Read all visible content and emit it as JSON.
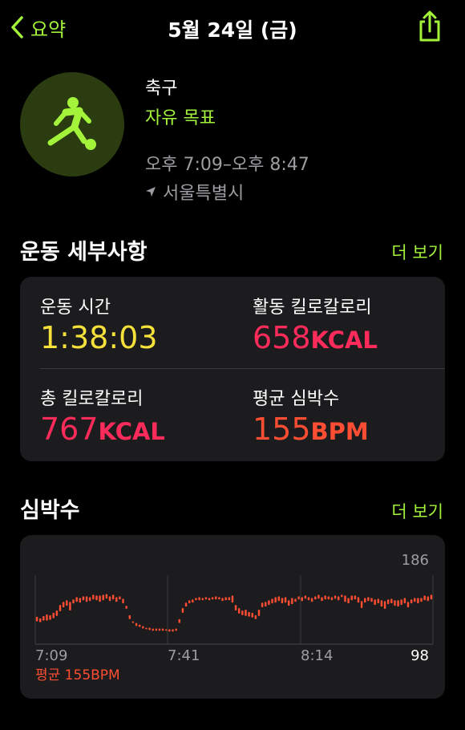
{
  "nav": {
    "back_label": "요약",
    "title": "5월 24일 (금)"
  },
  "workout": {
    "name": "축구",
    "goal": "자유 목표",
    "time_range": "오후 7:09–오후 8:47",
    "location": "서울특별시"
  },
  "details": {
    "title": "운동 세부사항",
    "more": "더 보기",
    "metrics": [
      {
        "label": "운동 시간",
        "value": "1:38:03",
        "unit": "",
        "color": "#f5e13a"
      },
      {
        "label": "활동 킬로칼로리",
        "value": "658",
        "unit": "KCAL",
        "color": "#fc2b5a"
      },
      {
        "label": "총 킬로칼로리",
        "value": "767",
        "unit": "KCAL",
        "color": "#fc2b5a"
      },
      {
        "label": "평균 심박수",
        "value": "155",
        "unit": "BPM",
        "color": "#fd4d32"
      }
    ]
  },
  "heart": {
    "title": "심박수",
    "more": "더 보기",
    "avg_label": "평균 155BPM"
  },
  "colors": {
    "accent": "#a3f33b",
    "heart_line": "#fd4d32"
  },
  "chart_data": {
    "type": "bar",
    "ylim": [
      98,
      186
    ],
    "y_tick_labels": [
      "186",
      "98"
    ],
    "x_tick_labels": [
      "7:09",
      "7:41",
      "8:14"
    ],
    "values": [
      [
        133,
        127
      ],
      [
        131,
        126
      ],
      [
        134,
        128
      ],
      [
        136,
        128
      ],
      [
        135,
        129
      ],
      [
        138,
        131
      ],
      [
        141,
        134
      ],
      [
        148,
        140
      ],
      [
        152,
        145
      ],
      [
        154,
        147
      ],
      [
        152,
        141
      ],
      [
        155,
        150
      ],
      [
        158,
        152
      ],
      [
        157,
        151
      ],
      [
        159,
        154
      ],
      [
        159,
        152
      ],
      [
        158,
        153
      ],
      [
        161,
        155
      ],
      [
        160,
        154
      ],
      [
        160,
        152
      ],
      [
        161,
        154
      ],
      [
        162,
        156
      ],
      [
        159,
        153
      ],
      [
        161,
        155
      ],
      [
        158,
        152
      ],
      [
        159,
        155
      ],
      [
        156,
        150
      ],
      [
        147,
        143
      ],
      [
        135,
        130
      ],
      [
        127,
        125
      ],
      [
        125,
        121
      ],
      [
        123,
        120
      ],
      [
        121,
        118
      ],
      [
        119,
        117
      ],
      [
        119,
        116
      ],
      [
        118,
        115
      ],
      [
        118,
        115
      ],
      [
        118,
        115
      ],
      [
        118,
        115
      ],
      [
        117,
        115
      ],
      [
        117,
        114
      ],
      [
        117,
        114
      ],
      [
        118,
        115
      ],
      [
        130,
        125
      ],
      [
        144,
        138
      ],
      [
        151,
        146
      ],
      [
        154,
        150
      ],
      [
        155,
        151
      ],
      [
        157,
        154
      ],
      [
        158,
        154
      ],
      [
        157,
        154
      ],
      [
        158,
        155
      ],
      [
        157,
        154
      ],
      [
        158,
        155
      ],
      [
        159,
        155
      ],
      [
        158,
        155
      ],
      [
        157,
        153
      ],
      [
        158,
        154
      ],
      [
        158,
        154
      ],
      [
        160,
        151
      ],
      [
        148,
        141
      ],
      [
        144,
        137
      ],
      [
        141,
        135
      ],
      [
        142,
        134
      ],
      [
        139,
        133
      ],
      [
        138,
        132
      ],
      [
        135,
        130
      ],
      [
        142,
        134
      ],
      [
        151,
        145
      ],
      [
        152,
        146
      ],
      [
        154,
        148
      ],
      [
        156,
        150
      ],
      [
        158,
        151
      ],
      [
        159,
        153
      ],
      [
        157,
        150
      ],
      [
        158,
        151
      ],
      [
        154,
        147
      ],
      [
        157,
        149
      ],
      [
        156,
        152
      ],
      [
        159,
        155
      ],
      [
        158,
        153
      ],
      [
        160,
        156
      ],
      [
        158,
        154
      ],
      [
        157,
        152
      ],
      [
        159,
        155
      ],
      [
        161,
        156
      ],
      [
        158,
        153
      ],
      [
        160,
        155
      ],
      [
        159,
        155
      ],
      [
        158,
        154
      ],
      [
        160,
        156
      ],
      [
        159,
        154
      ],
      [
        161,
        158
      ],
      [
        160,
        152
      ],
      [
        157,
        150
      ],
      [
        160,
        154
      ],
      [
        160,
        155
      ],
      [
        158,
        151
      ],
      [
        153,
        144
      ],
      [
        157,
        151
      ],
      [
        158,
        153
      ],
      [
        157,
        152
      ],
      [
        155,
        148
      ],
      [
        156,
        150
      ],
      [
        154,
        146
      ],
      [
        153,
        143
      ],
      [
        155,
        149
      ],
      [
        156,
        150
      ],
      [
        154,
        147
      ],
      [
        154,
        146
      ],
      [
        155,
        148
      ],
      [
        157,
        150
      ],
      [
        152,
        145
      ],
      [
        155,
        150
      ],
      [
        157,
        152
      ],
      [
        157,
        150
      ],
      [
        157,
        152
      ],
      [
        160,
        154
      ],
      [
        159,
        153
      ],
      [
        161,
        155
      ]
    ]
  }
}
